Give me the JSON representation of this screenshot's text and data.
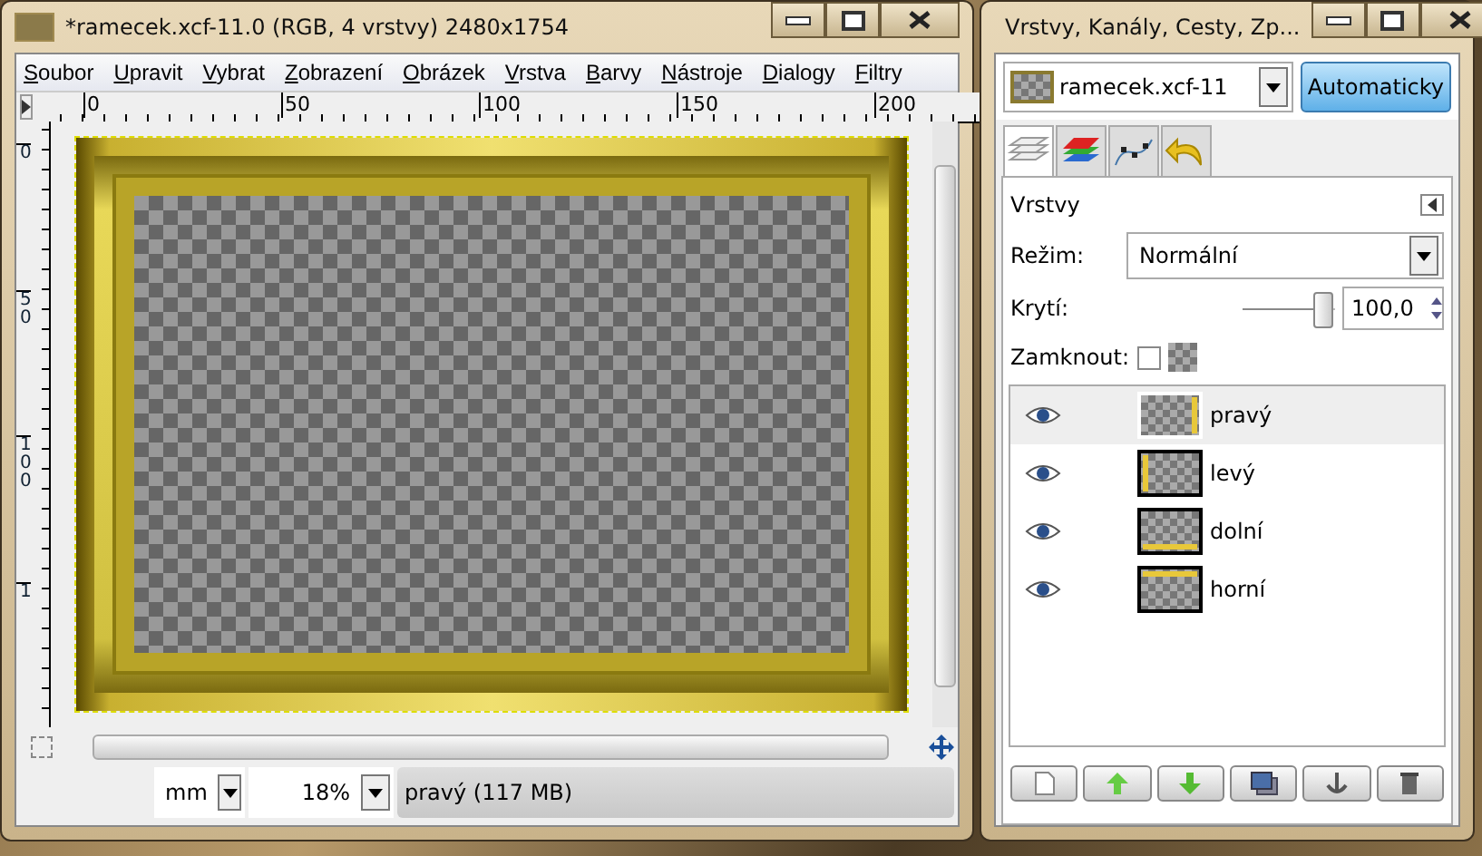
{
  "image_window": {
    "title": "*ramecek.xcf-11.0 (RGB, 4 vrstvy) 2480x1754",
    "menu": [
      "Soubor",
      "Upravit",
      "Vybrat",
      "Zobrazení",
      "Obrázek",
      "Vrstva",
      "Barvy",
      "Nástroje",
      "Dialogy",
      "Filtry"
    ],
    "top_ruler": [
      "0",
      "50",
      "100",
      "150",
      "200"
    ],
    "left_ruler": [
      "0",
      "50",
      "100",
      "1"
    ],
    "status_bar": {
      "unit": "mm",
      "zoom": "18%",
      "message": "pravý (117 MB)"
    }
  },
  "layers_window": {
    "title": "Vrstvy, Kanály, Cesty, Zp...",
    "image_select": "ramecek.xcf-11",
    "auto_button": "Automaticky",
    "tabs": [
      {
        "kind": "layers",
        "selected": true
      },
      {
        "kind": "channels",
        "selected": false
      },
      {
        "kind": "paths",
        "selected": false
      },
      {
        "kind": "undo",
        "selected": false
      }
    ],
    "panel_title": "Vrstvy",
    "mode_label": "Režim:",
    "mode": "Normální",
    "opacity_label": "Krytí:",
    "opacity": {
      "level": 1.0,
      "value": "100,0"
    },
    "lock_label": "Zamknout:",
    "lock_checked": false,
    "layers": [
      {
        "name": "pravý",
        "kind": "right",
        "visible": true,
        "selected": true
      },
      {
        "name": "levý",
        "kind": "left",
        "visible": true,
        "selected": false
      },
      {
        "name": "dolní",
        "kind": "bottom",
        "visible": true,
        "selected": false
      },
      {
        "name": "horní",
        "kind": "top",
        "visible": true,
        "selected": false
      }
    ],
    "buttons": [
      {
        "kind": "new"
      },
      {
        "kind": "raise"
      },
      {
        "kind": "lower"
      },
      {
        "kind": "duplicate"
      },
      {
        "kind": "anchor"
      },
      {
        "kind": "delete"
      }
    ]
  }
}
